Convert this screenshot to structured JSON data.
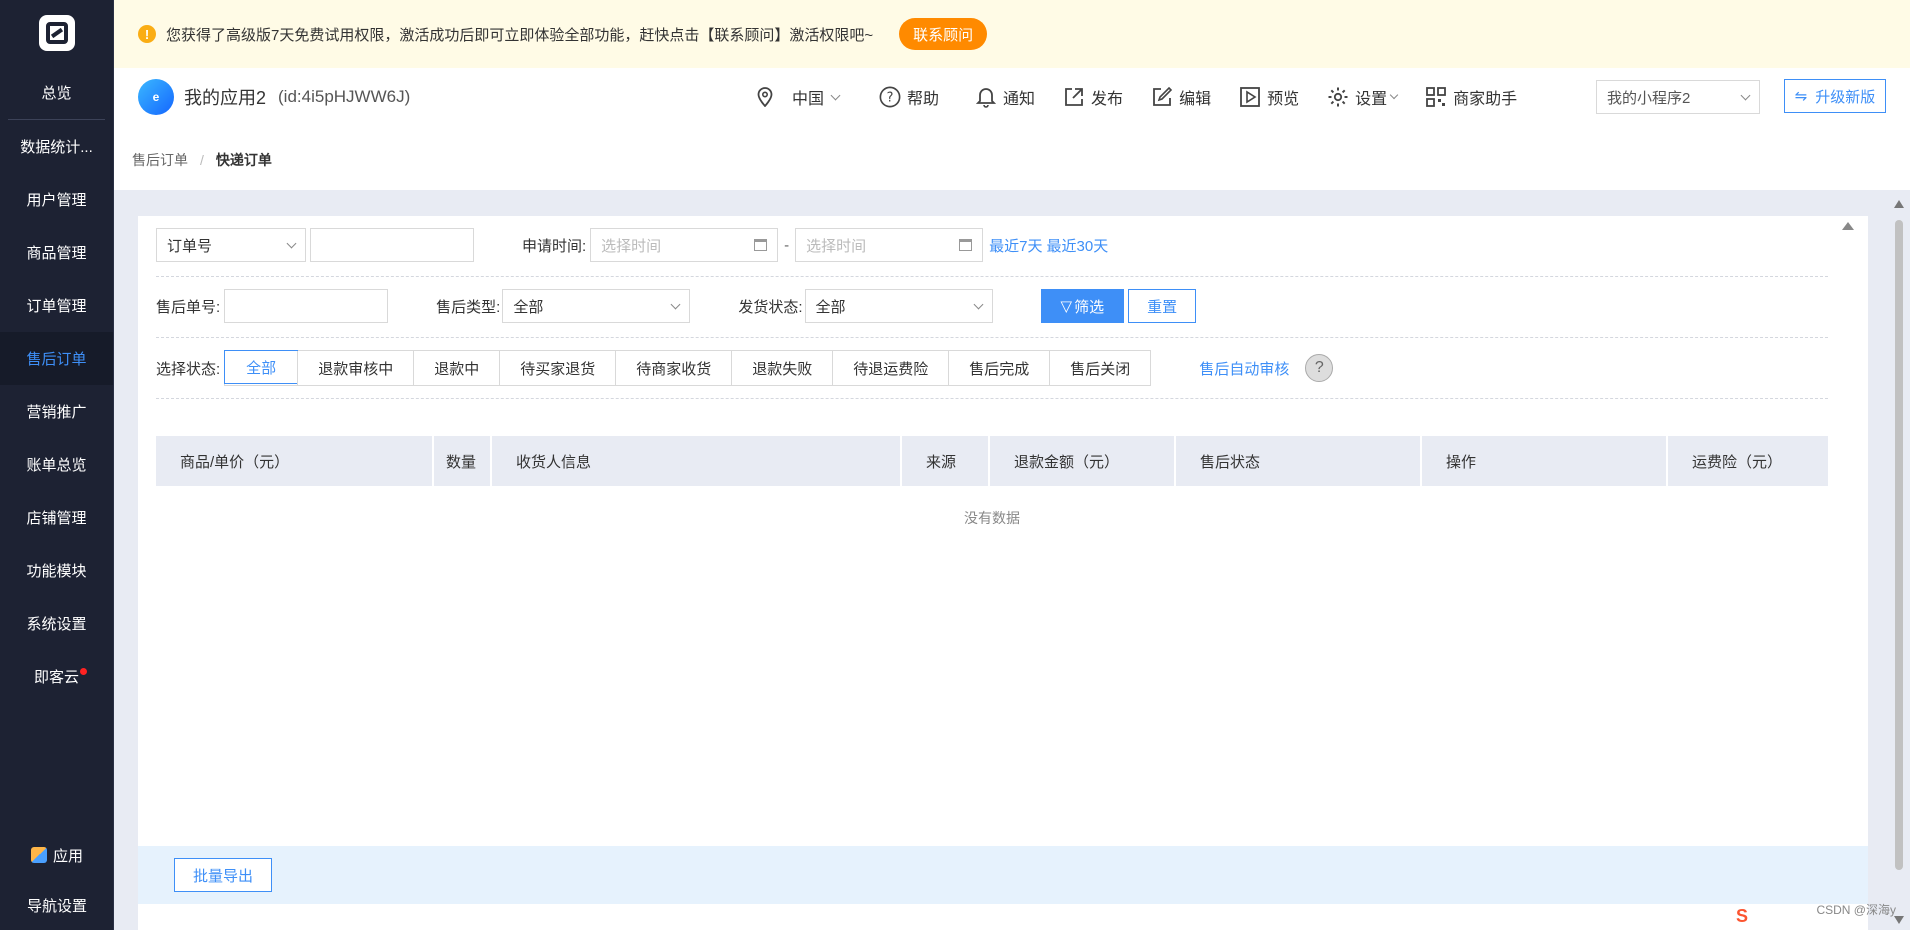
{
  "sidebar": {
    "items": [
      {
        "label": "总览",
        "active": false
      },
      {
        "label": "数据统计...",
        "active": false
      },
      {
        "label": "用户管理",
        "active": false
      },
      {
        "label": "商品管理",
        "active": false
      },
      {
        "label": "订单管理",
        "active": false
      },
      {
        "label": "售后订单",
        "active": true
      },
      {
        "label": "营销推广",
        "active": false
      },
      {
        "label": "账单总览",
        "active": false
      },
      {
        "label": "店铺管理",
        "active": false
      },
      {
        "label": "功能模块",
        "active": false
      },
      {
        "label": "系统设置",
        "active": false
      },
      {
        "label": "即客云",
        "active": false
      }
    ],
    "bottom": {
      "app": "应用",
      "nav_settings": "导航设置"
    }
  },
  "banner": {
    "text": "您获得了高级版7天免费试用权限，激活成功后即可立即体验全部功能，赶快点击【联系顾问】激活权限吧~",
    "button": "联系顾问"
  },
  "header": {
    "app_name": "我的应用2",
    "app_id": "(id:4i5pHJWW6J)",
    "region": "中国",
    "help": "帮助",
    "notify": "通知",
    "publish": "发布",
    "edit": "编辑",
    "preview": "预览",
    "settings": "设置",
    "merchant": "商家助手",
    "mini_program": "我的小程序2",
    "upgrade": "升级新版"
  },
  "breadcrumb": {
    "parent": "售后订单",
    "sep": "/",
    "current": "快递订单"
  },
  "filters": {
    "search_type": "订单号",
    "apply_time_label": "申请时间:",
    "date_start_placeholder": "选择时间",
    "date_sep": "-",
    "date_end_placeholder": "选择时间",
    "recent7": "最近7天",
    "recent30": "最近30天",
    "aftersale_no_label": "售后单号:",
    "aftersale_type_label": "售后类型:",
    "aftersale_type_value": "全部",
    "ship_status_label": "发货状态:",
    "ship_status_value": "全部",
    "filter_btn": "筛选",
    "reset_btn": "重置",
    "status_label": "选择状态:",
    "statuses": [
      "全部",
      "退款审核中",
      "退款中",
      "待买家退货",
      "待商家收货",
      "退款失败",
      "待退运费险",
      "售后完成",
      "售后关闭"
    ],
    "auto_review": "售后自动审核",
    "help_q": "?"
  },
  "table": {
    "columns": [
      "商品/单价（元）",
      "数量",
      "收货人信息",
      "来源",
      "退款金额（元）",
      "售后状态",
      "操作",
      "运费险（元）"
    ],
    "empty_text": "没有数据"
  },
  "footer": {
    "export": "批量导出"
  },
  "watermark": "CSDN @深海y",
  "colors": {
    "primary": "#3e8ff7",
    "sidebar": "#1d2233",
    "banner_btn": "#ff8a00",
    "banner_bg": "#fffbe6"
  }
}
